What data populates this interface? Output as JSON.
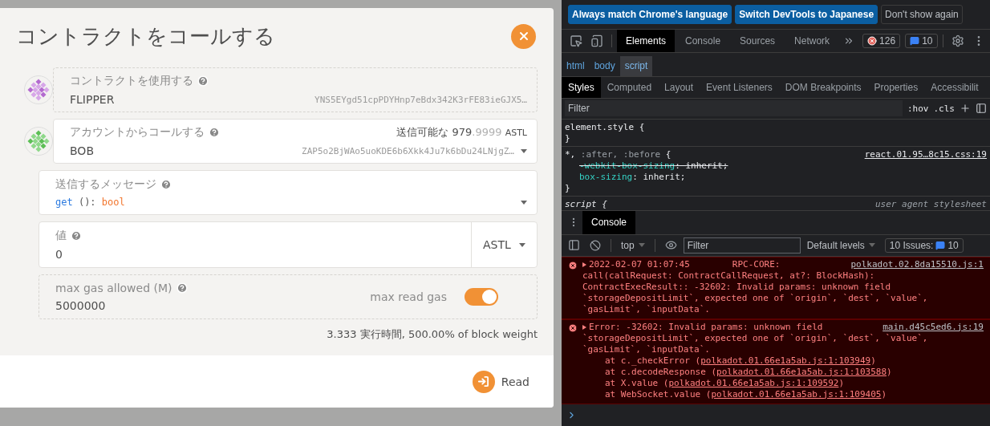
{
  "dialog": {
    "title": "コントラクトをコールする",
    "contract": {
      "label": "コントラクトを使用する",
      "name": "FLIPPER",
      "address": "YNS5EYgd51cpPDYHnp7eBdx342K3rFE83ieGJX5…"
    },
    "account": {
      "label": "アカウントからコールする",
      "balance_label": "送信可能な",
      "balance_int": "979",
      "balance_dec": ".9999",
      "balance_unit": "ASTL",
      "name": "BOB",
      "address": "ZAP5o2BjWAo5uoKDE6b6Xkk4Ju7k6bDu24LNjgZ…"
    },
    "message": {
      "label": "送信するメッセージ",
      "method": "get",
      "args": " ():",
      "return_type": "bool"
    },
    "value": {
      "label": "値",
      "value": "0",
      "unit": "ASTL"
    },
    "gas": {
      "label": "max gas allowed (M)",
      "value": "5000000",
      "toggle_label": "max read gas",
      "on": true
    },
    "weight_note": "3.333 実行時間, 500.00% of block weight",
    "read_button": "Read"
  },
  "devtools": {
    "banner_buttons": [
      {
        "label": "Always match Chrome's language",
        "kind": "primary"
      },
      {
        "label": "Switch DevTools to Japanese",
        "kind": "primary"
      },
      {
        "label": "Don't show again",
        "kind": "plain"
      }
    ],
    "tabs": [
      {
        "label": "Elements",
        "selected": true
      },
      {
        "label": "Console",
        "selected": false
      },
      {
        "label": "Sources",
        "selected": false
      },
      {
        "label": "Network",
        "selected": false
      }
    ],
    "error_count": "126",
    "message_count": "10",
    "breadcrumbs": [
      {
        "label": "html",
        "selected": false
      },
      {
        "label": "body",
        "selected": false
      },
      {
        "label": "script",
        "selected": true
      }
    ],
    "style_tabs": [
      {
        "label": "Styles",
        "selected": true
      },
      {
        "label": "Computed",
        "selected": false
      },
      {
        "label": "Layout",
        "selected": false
      },
      {
        "label": "Event Listeners",
        "selected": false
      },
      {
        "label": "DOM Breakpoints",
        "selected": false
      },
      {
        "label": "Properties",
        "selected": false
      },
      {
        "label": "Accessibilit",
        "selected": false
      }
    ],
    "styles_filter_placeholder": "Filter",
    "hov": ":hov",
    "cls": ".cls",
    "rules": [
      {
        "selector": "element.style",
        "rest": " {",
        "italic": false,
        "close": "}"
      },
      {
        "selector": "*,",
        "pseudo": " :after, :before",
        "rest": " {",
        "source": "react.01.95…8c15.css:19",
        "italic": false,
        "props": [
          {
            "name": "-webkit-box-sizing",
            "rest": ": inherit;",
            "struck": true
          },
          {
            "name": "box-sizing",
            "rest": ": inherit;",
            "struck": false
          }
        ],
        "close": "}"
      },
      {
        "selector": "script",
        "rest": " {",
        "source": "user agent stylesheet",
        "italic": true
      }
    ],
    "drawer_tab": "Console",
    "console_context": "top",
    "console_filter_placeholder": "Filter",
    "levels": "Default levels",
    "issues_label": "10 Issues:",
    "issues_count": "10",
    "errors": [
      {
        "first": "2022-02-07 01:07:45        RPC-CORE:",
        "source": "polkadot.02.8da15510.js:1",
        "lines": [
          "call(callRequest: ContractCallRequest, at?: BlockHash):",
          "ContractExecResult:: -32602: Invalid params: unknown field",
          "`storageDepositLimit`, expected one of `origin`, `dest`, `value`,",
          "`gasLimit`, `inputData`."
        ]
      },
      {
        "first": "Error: -32602: Invalid params: unknown field",
        "source": "main.d45c5ed6.js:19",
        "lines": [
          "`storageDepositLimit`, expected one of `origin`, `dest`, `value`,",
          "`gasLimit`, `inputData`."
        ],
        "stack": [
          {
            "prefix": "at c._checkError (",
            "link": "polkadot.01.66e1a5ab.js:1:103949",
            "suffix": ")"
          },
          {
            "prefix": "at c.decodeResponse (",
            "link": "polkadot.01.66e1a5ab.js:1:103588",
            "suffix": ")"
          },
          {
            "prefix": "at X.value (",
            "link": "polkadot.01.66e1a5ab.js:1:109592",
            "suffix": ")"
          },
          {
            "prefix": "at WebSocket.value (",
            "link": "polkadot.01.66e1a5ab.js:1:109405",
            "suffix": ")"
          }
        ]
      }
    ]
  }
}
